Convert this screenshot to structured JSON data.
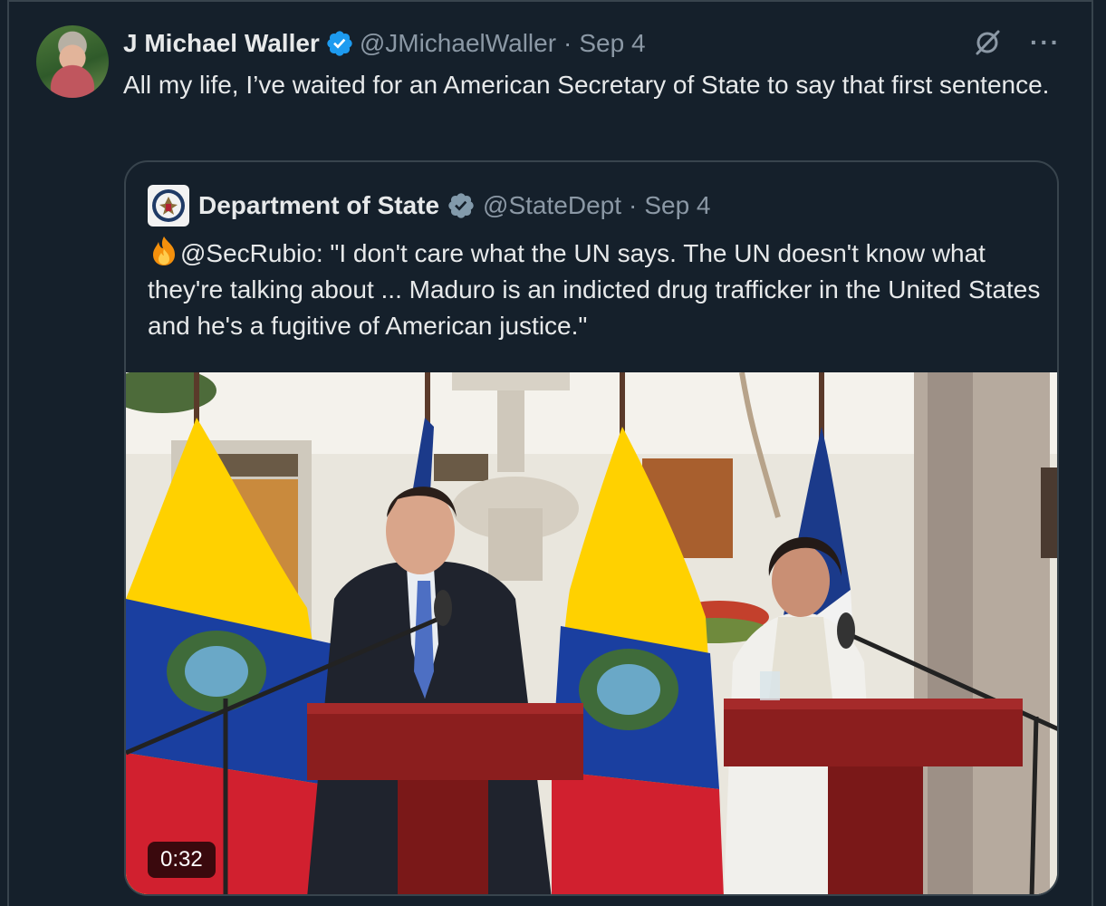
{
  "tweet": {
    "author_name": "J Michael Waller",
    "author_handle": "@JMichaelWaller",
    "separator": "·",
    "date": "Sep 4",
    "text": "All my life, I’ve waited for an American Secretary of State to say that first sentence."
  },
  "quoted": {
    "author_name": "Department of State",
    "author_handle": "@StateDept",
    "separator": "·",
    "date": "Sep 4",
    "text": "@SecRubio: \"I don't care what the UN says. The UN doesn't know what they're talking about ... Maduro is an indicted drug trafficker in the United States and he's a fugitive of American justice.\""
  },
  "video": {
    "duration": "0:32"
  },
  "icons": {
    "verified": "verified-badge-icon",
    "grok": "grok-icon",
    "more": "more-options-icon",
    "fire": "fire-emoji-icon"
  },
  "colors": {
    "background": "#15202b",
    "text": "#e7e9ea",
    "muted": "#8b98a5",
    "verified_blue": "#1d9bf0",
    "verified_gray": "#829aab",
    "border": "#38444d"
  }
}
